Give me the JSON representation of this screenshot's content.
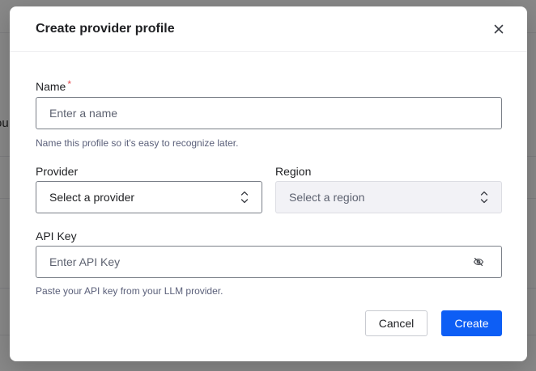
{
  "background": {
    "partial_text": "ou"
  },
  "modal": {
    "title": "Create provider profile",
    "close_icon": "close-icon",
    "name": {
      "label": "Name",
      "required_mark": "*",
      "placeholder": "Enter a name",
      "value": "",
      "helper": "Name this profile so it's easy to recognize later."
    },
    "provider": {
      "label": "Provider",
      "selected": "Select a provider"
    },
    "region": {
      "label": "Region",
      "selected": "Select a region",
      "disabled": true
    },
    "api_key": {
      "label": "API Key",
      "placeholder": "Enter API Key",
      "value": "",
      "helper": "Paste your API key from your LLM provider.",
      "toggle_icon": "eye-off-icon"
    },
    "buttons": {
      "cancel": "Cancel",
      "create": "Create"
    }
  },
  "colors": {
    "primary": "#0d5ef5",
    "required": "#e5484d",
    "helper_text": "#5b607a"
  }
}
